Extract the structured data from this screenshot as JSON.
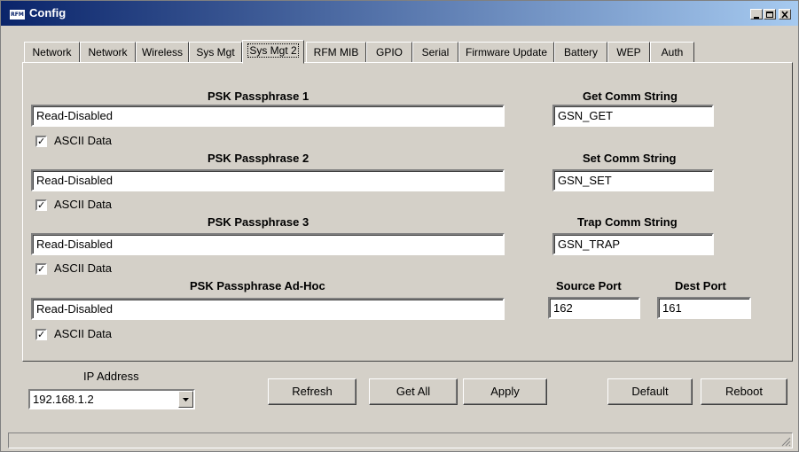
{
  "window": {
    "title": "Config",
    "icon_text": "RFM",
    "minimize_label": "_",
    "maximize_label": "□",
    "close_label": "×"
  },
  "tabs": [
    {
      "label": "Network"
    },
    {
      "label": "Network"
    },
    {
      "label": "Wireless"
    },
    {
      "label": "Sys Mgt"
    },
    {
      "label": "Sys Mgt 2",
      "active": true
    },
    {
      "label": "RFM MIB"
    },
    {
      "label": "GPIO"
    },
    {
      "label": "Serial"
    },
    {
      "label": "Firmware Update"
    },
    {
      "label": "Battery"
    },
    {
      "label": "WEP"
    },
    {
      "label": "Auth"
    }
  ],
  "psk": [
    {
      "label": "PSK Passphrase 1",
      "value": "Read-Disabled",
      "ascii_label": "ASCII Data",
      "ascii_checked": true
    },
    {
      "label": "PSK Passphrase 2",
      "value": "Read-Disabled",
      "ascii_label": "ASCII Data",
      "ascii_checked": true
    },
    {
      "label": "PSK Passphrase 3",
      "value": "Read-Disabled",
      "ascii_label": "ASCII Data",
      "ascii_checked": true
    },
    {
      "label": "PSK Passphrase Ad-Hoc",
      "value": "Read-Disabled",
      "ascii_label": "ASCII Data",
      "ascii_checked": true
    }
  ],
  "snmp": {
    "get_label": "Get Comm String",
    "get_value": "GSN_GET",
    "set_label": "Set Comm String",
    "set_value": "GSN_SET",
    "trap_label": "Trap Comm String",
    "trap_value": "GSN_TRAP",
    "source_port_label": "Source Port",
    "source_port_value": "162",
    "dest_port_label": "Dest Port",
    "dest_port_value": "161"
  },
  "footer": {
    "ip_label": "IP Address",
    "ip_value": "192.168.1.2",
    "refresh": "Refresh",
    "get_all": "Get All",
    "apply": "Apply",
    "default": "Default",
    "reboot": "Reboot"
  },
  "check_glyph": "✓"
}
